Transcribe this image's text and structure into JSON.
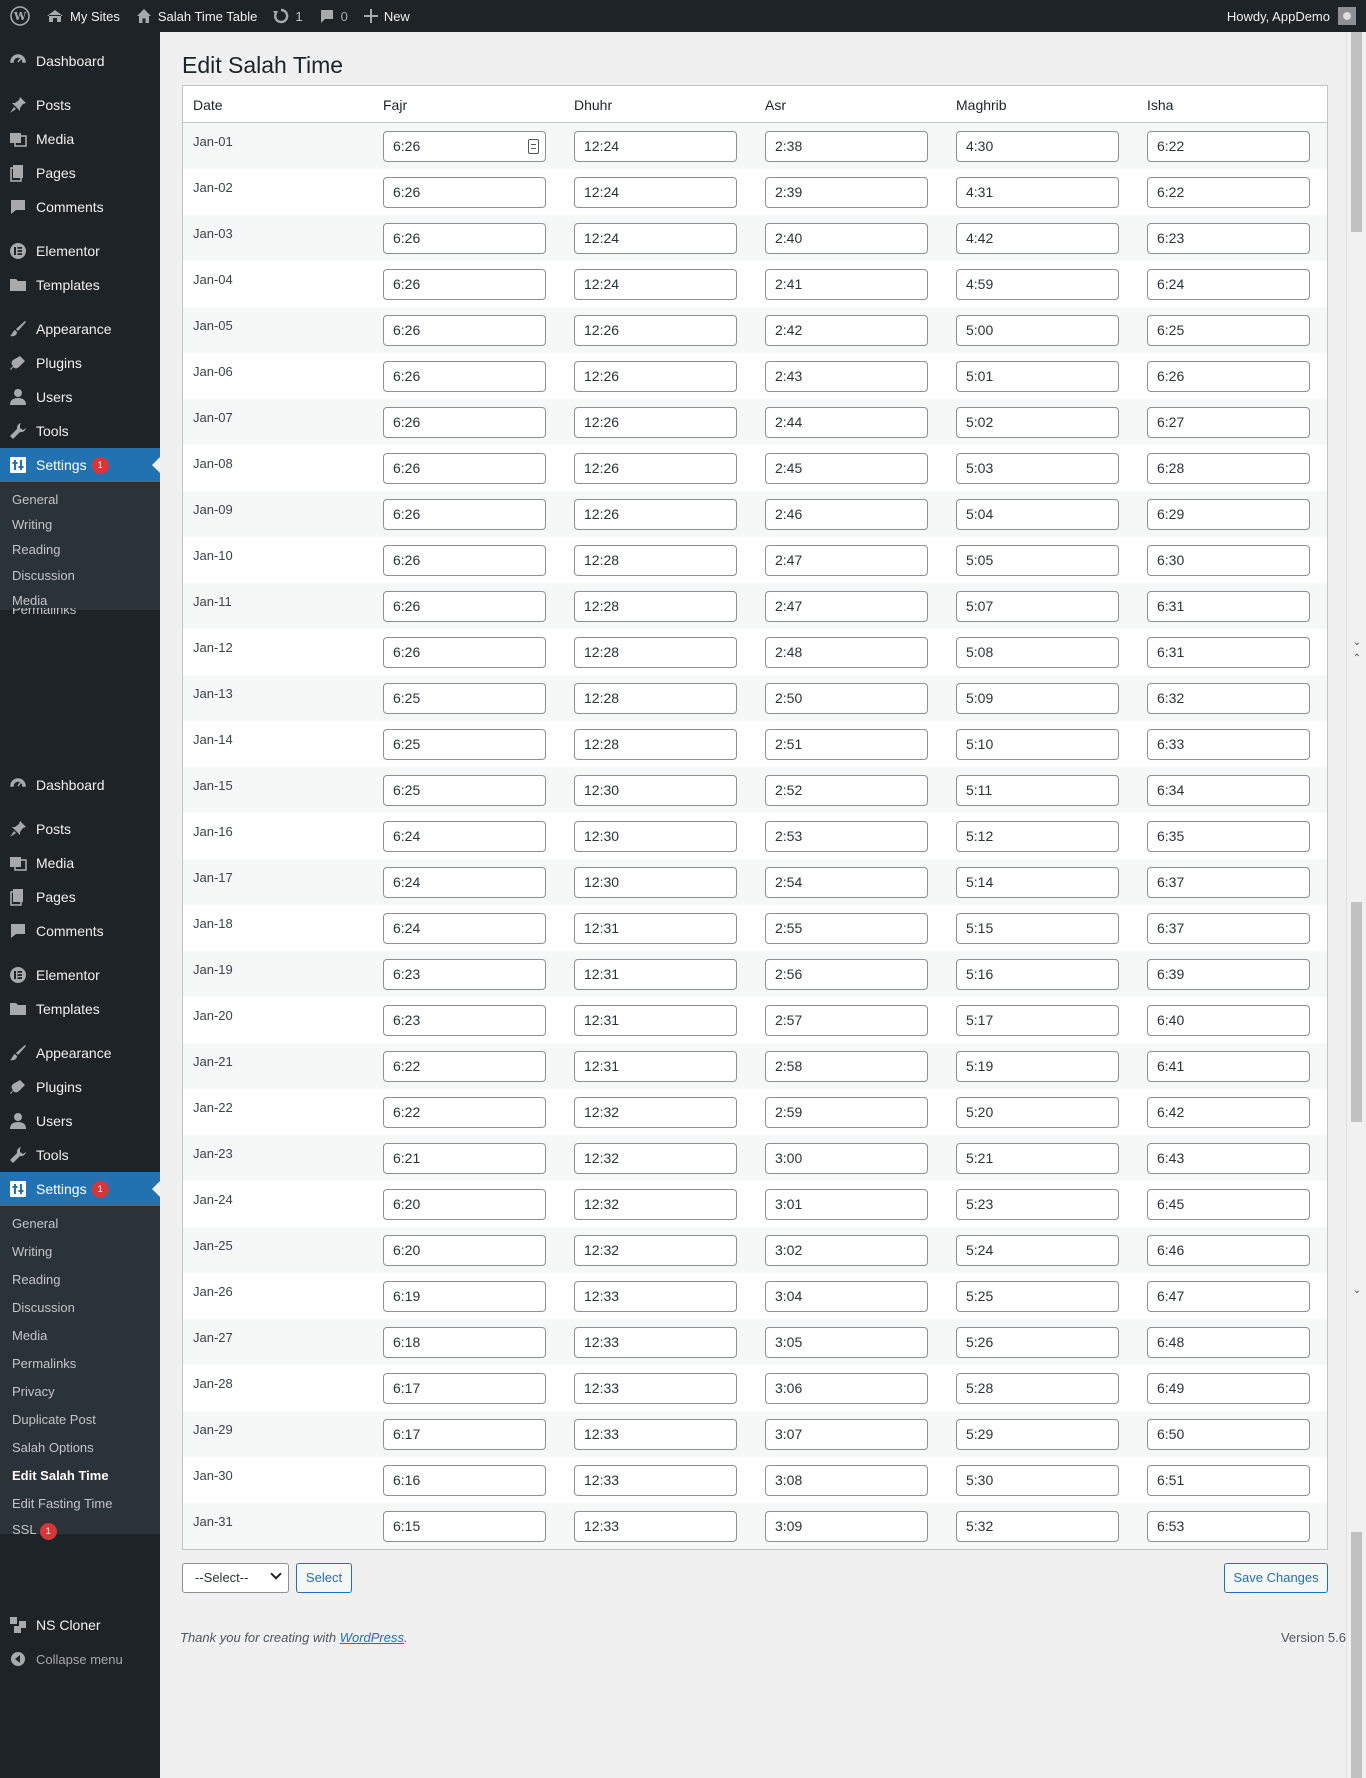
{
  "adminbar": {
    "my_sites": "My Sites",
    "site_name": "Salah Time Table",
    "updates_count": "1",
    "comments_count": "0",
    "new_label": "New",
    "greeting": "Howdy, AppDemo"
  },
  "sidebar": {
    "menu": [
      "Dashboard",
      "Posts",
      "Media",
      "Pages",
      "Comments",
      "Elementor",
      "Templates",
      "Appearance",
      "Plugins",
      "Users",
      "Tools",
      "Settings"
    ],
    "settings_badge": "1",
    "submenu_top": [
      "General",
      "Writing",
      "Reading",
      "Discussion",
      "Media",
      "Permalinks"
    ],
    "submenu": [
      "General",
      "Writing",
      "Reading",
      "Discussion",
      "Media",
      "Permalinks",
      "Privacy",
      "Duplicate Post",
      "Salah Options",
      "Edit Salah Time",
      "Edit Fasting Time",
      "SSL"
    ],
    "ssl_badge": "1",
    "ns_cloner": "NS Cloner",
    "collapse": "Collapse menu"
  },
  "page": {
    "title": "Edit Salah Time",
    "columns": [
      "Date",
      "Fajr",
      "Dhuhr",
      "Asr",
      "Maghrib",
      "Isha"
    ],
    "rows": [
      {
        "date": "Jan-01",
        "fajr": "6:26",
        "dhuhr": "12:24",
        "asr": "2:38",
        "maghrib": "4:30",
        "isha": "6:22"
      },
      {
        "date": "Jan-02",
        "fajr": "6:26",
        "dhuhr": "12:24",
        "asr": "2:39",
        "maghrib": "4:31",
        "isha": "6:22"
      },
      {
        "date": "Jan-03",
        "fajr": "6:26",
        "dhuhr": "12:24",
        "asr": "2:40",
        "maghrib": "4:42",
        "isha": "6:23"
      },
      {
        "date": "Jan-04",
        "fajr": "6:26",
        "dhuhr": "12:24",
        "asr": "2:41",
        "maghrib": "4:59",
        "isha": "6:24"
      },
      {
        "date": "Jan-05",
        "fajr": "6:26",
        "dhuhr": "12:26",
        "asr": "2:42",
        "maghrib": "5:00",
        "isha": "6:25"
      },
      {
        "date": "Jan-06",
        "fajr": "6:26",
        "dhuhr": "12:26",
        "asr": "2:43",
        "maghrib": "5:01",
        "isha": "6:26"
      },
      {
        "date": "Jan-07",
        "fajr": "6:26",
        "dhuhr": "12:26",
        "asr": "2:44",
        "maghrib": "5:02",
        "isha": "6:27"
      },
      {
        "date": "Jan-08",
        "fajr": "6:26",
        "dhuhr": "12:26",
        "asr": "2:45",
        "maghrib": "5:03",
        "isha": "6:28"
      },
      {
        "date": "Jan-09",
        "fajr": "6:26",
        "dhuhr": "12:26",
        "asr": "2:46",
        "maghrib": "5:04",
        "isha": "6:29"
      },
      {
        "date": "Jan-10",
        "fajr": "6:26",
        "dhuhr": "12:28",
        "asr": "2:47",
        "maghrib": "5:05",
        "isha": "6:30"
      },
      {
        "date": "Jan-11",
        "fajr": "6:26",
        "dhuhr": "12:28",
        "asr": "2:47",
        "maghrib": "5:07",
        "isha": "6:31"
      },
      {
        "date": "Jan-12",
        "fajr": "6:26",
        "dhuhr": "12:28",
        "asr": "2:48",
        "maghrib": "5:08",
        "isha": "6:31"
      },
      {
        "date": "Jan-13",
        "fajr": "6:25",
        "dhuhr": "12:28",
        "asr": "2:50",
        "maghrib": "5:09",
        "isha": "6:32"
      },
      {
        "date": "Jan-14",
        "fajr": "6:25",
        "dhuhr": "12:28",
        "asr": "2:51",
        "maghrib": "5:10",
        "isha": "6:33"
      },
      {
        "date": "Jan-15",
        "fajr": "6:25",
        "dhuhr": "12:30",
        "asr": "2:52",
        "maghrib": "5:11",
        "isha": "6:34"
      },
      {
        "date": "Jan-16",
        "fajr": "6:24",
        "dhuhr": "12:30",
        "asr": "2:53",
        "maghrib": "5:12",
        "isha": "6:35"
      },
      {
        "date": "Jan-17",
        "fajr": "6:24",
        "dhuhr": "12:30",
        "asr": "2:54",
        "maghrib": "5:14",
        "isha": "6:37"
      },
      {
        "date": "Jan-18",
        "fajr": "6:24",
        "dhuhr": "12:31",
        "asr": "2:55",
        "maghrib": "5:15",
        "isha": "6:37"
      },
      {
        "date": "Jan-19",
        "fajr": "6:23",
        "dhuhr": "12:31",
        "asr": "2:56",
        "maghrib": "5:16",
        "isha": "6:39"
      },
      {
        "date": "Jan-20",
        "fajr": "6:23",
        "dhuhr": "12:31",
        "asr": "2:57",
        "maghrib": "5:17",
        "isha": "6:40"
      },
      {
        "date": "Jan-21",
        "fajr": "6:22",
        "dhuhr": "12:31",
        "asr": "2:58",
        "maghrib": "5:19",
        "isha": "6:41"
      },
      {
        "date": "Jan-22",
        "fajr": "6:22",
        "dhuhr": "12:32",
        "asr": "2:59",
        "maghrib": "5:20",
        "isha": "6:42"
      },
      {
        "date": "Jan-23",
        "fajr": "6:21",
        "dhuhr": "12:32",
        "asr": "3:00",
        "maghrib": "5:21",
        "isha": "6:43"
      },
      {
        "date": "Jan-24",
        "fajr": "6:20",
        "dhuhr": "12:32",
        "asr": "3:01",
        "maghrib": "5:23",
        "isha": "6:45"
      },
      {
        "date": "Jan-25",
        "fajr": "6:20",
        "dhuhr": "12:32",
        "asr": "3:02",
        "maghrib": "5:24",
        "isha": "6:46"
      },
      {
        "date": "Jan-26",
        "fajr": "6:19",
        "dhuhr": "12:33",
        "asr": "3:04",
        "maghrib": "5:25",
        "isha": "6:47"
      },
      {
        "date": "Jan-27",
        "fajr": "6:18",
        "dhuhr": "12:33",
        "asr": "3:05",
        "maghrib": "5:26",
        "isha": "6:48"
      },
      {
        "date": "Jan-28",
        "fajr": "6:17",
        "dhuhr": "12:33",
        "asr": "3:06",
        "maghrib": "5:28",
        "isha": "6:49"
      },
      {
        "date": "Jan-29",
        "fajr": "6:17",
        "dhuhr": "12:33",
        "asr": "3:07",
        "maghrib": "5:29",
        "isha": "6:50"
      },
      {
        "date": "Jan-30",
        "fajr": "6:16",
        "dhuhr": "12:33",
        "asr": "3:08",
        "maghrib": "5:30",
        "isha": "6:51"
      },
      {
        "date": "Jan-31",
        "fajr": "6:15",
        "dhuhr": "12:33",
        "asr": "3:09",
        "maghrib": "5:32",
        "isha": "6:53"
      }
    ],
    "select_value": "--Select--",
    "select_button": "Select",
    "save_button": "Save Changes"
  },
  "footer": {
    "thanks_prefix": "Thank you for creating with ",
    "thanks_link": "WordPress",
    "thanks_suffix": ".",
    "version": "Version 5.6"
  },
  "colors": {
    "admin_dark": "#1d2327",
    "accent": "#2271b1",
    "badge": "#d63638"
  }
}
